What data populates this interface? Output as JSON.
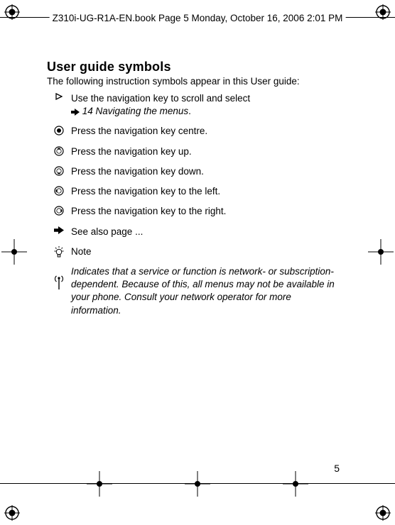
{
  "header": {
    "label": "Z310i-UG-R1A-EN.book  Page 5  Monday, October 16, 2006  2:01 PM"
  },
  "content": {
    "title": "User guide symbols",
    "intro": "The following instruction symbols appear in this User guide:",
    "rows": {
      "scroll_line1": "Use the navigation key to scroll and select",
      "scroll_link": "14 Navigating the menus",
      "scroll_suffix": ".",
      "centre": "Press the navigation key centre.",
      "up": "Press the navigation key up.",
      "down": "Press the navigation key down.",
      "left": "Press the navigation key to the left.",
      "right": "Press the navigation key to the right.",
      "seealso": "See also page ...",
      "note": "Note",
      "network": "Indicates that a service or function is network- or subscription-dependent. Because of this, all menus may not be available in your phone. Consult your network operator for more information."
    }
  },
  "page_number": "5"
}
